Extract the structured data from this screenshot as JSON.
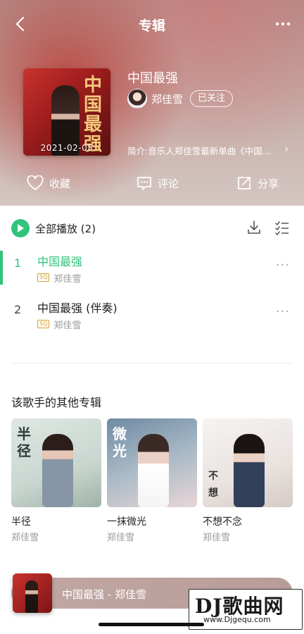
{
  "header": {
    "title": "专辑",
    "back_icon": "chevron-left-icon",
    "more_icon": "more-dots-icon"
  },
  "album": {
    "title": "中国最强",
    "cover_date": "2021-02-05",
    "cover_text": "中国最强",
    "artist": "郑佳雪",
    "follow_label": "已关注",
    "intro": "简介:音乐人郑佳雪最新单曲《中国…",
    "intro_arrow": "›"
  },
  "actions": {
    "favorite": "收藏",
    "comment": "评论",
    "share": "分享"
  },
  "playlist": {
    "play_all_label": "全部播放",
    "count": "(2)",
    "songs": [
      {
        "index": "1",
        "name": "中国最强",
        "quality": "SQ",
        "artist": "郑佳雪",
        "more": "···"
      },
      {
        "index": "2",
        "name": "中国最强 (伴奏)",
        "quality": "SQ",
        "artist": "郑佳雪",
        "more": "···"
      }
    ]
  },
  "other_albums": {
    "section_title": "该歌手的其他专辑",
    "items": [
      {
        "title": "半径",
        "artist": "郑佳雪",
        "cover_text": "半径"
      },
      {
        "title": "一抹微光",
        "artist": "郑佳雪",
        "cover_text": "微光"
      },
      {
        "title": "不想不念",
        "artist": "郑佳雪",
        "cover_text": "不想"
      }
    ]
  },
  "player": {
    "now_playing": "中国最强 - 郑佳雪"
  },
  "watermark": {
    "main": "DJ歌曲网",
    "url": "www.Djgequ.com"
  },
  "colors": {
    "accent": "#31c27c",
    "quality_badge": "#d49b2c"
  }
}
